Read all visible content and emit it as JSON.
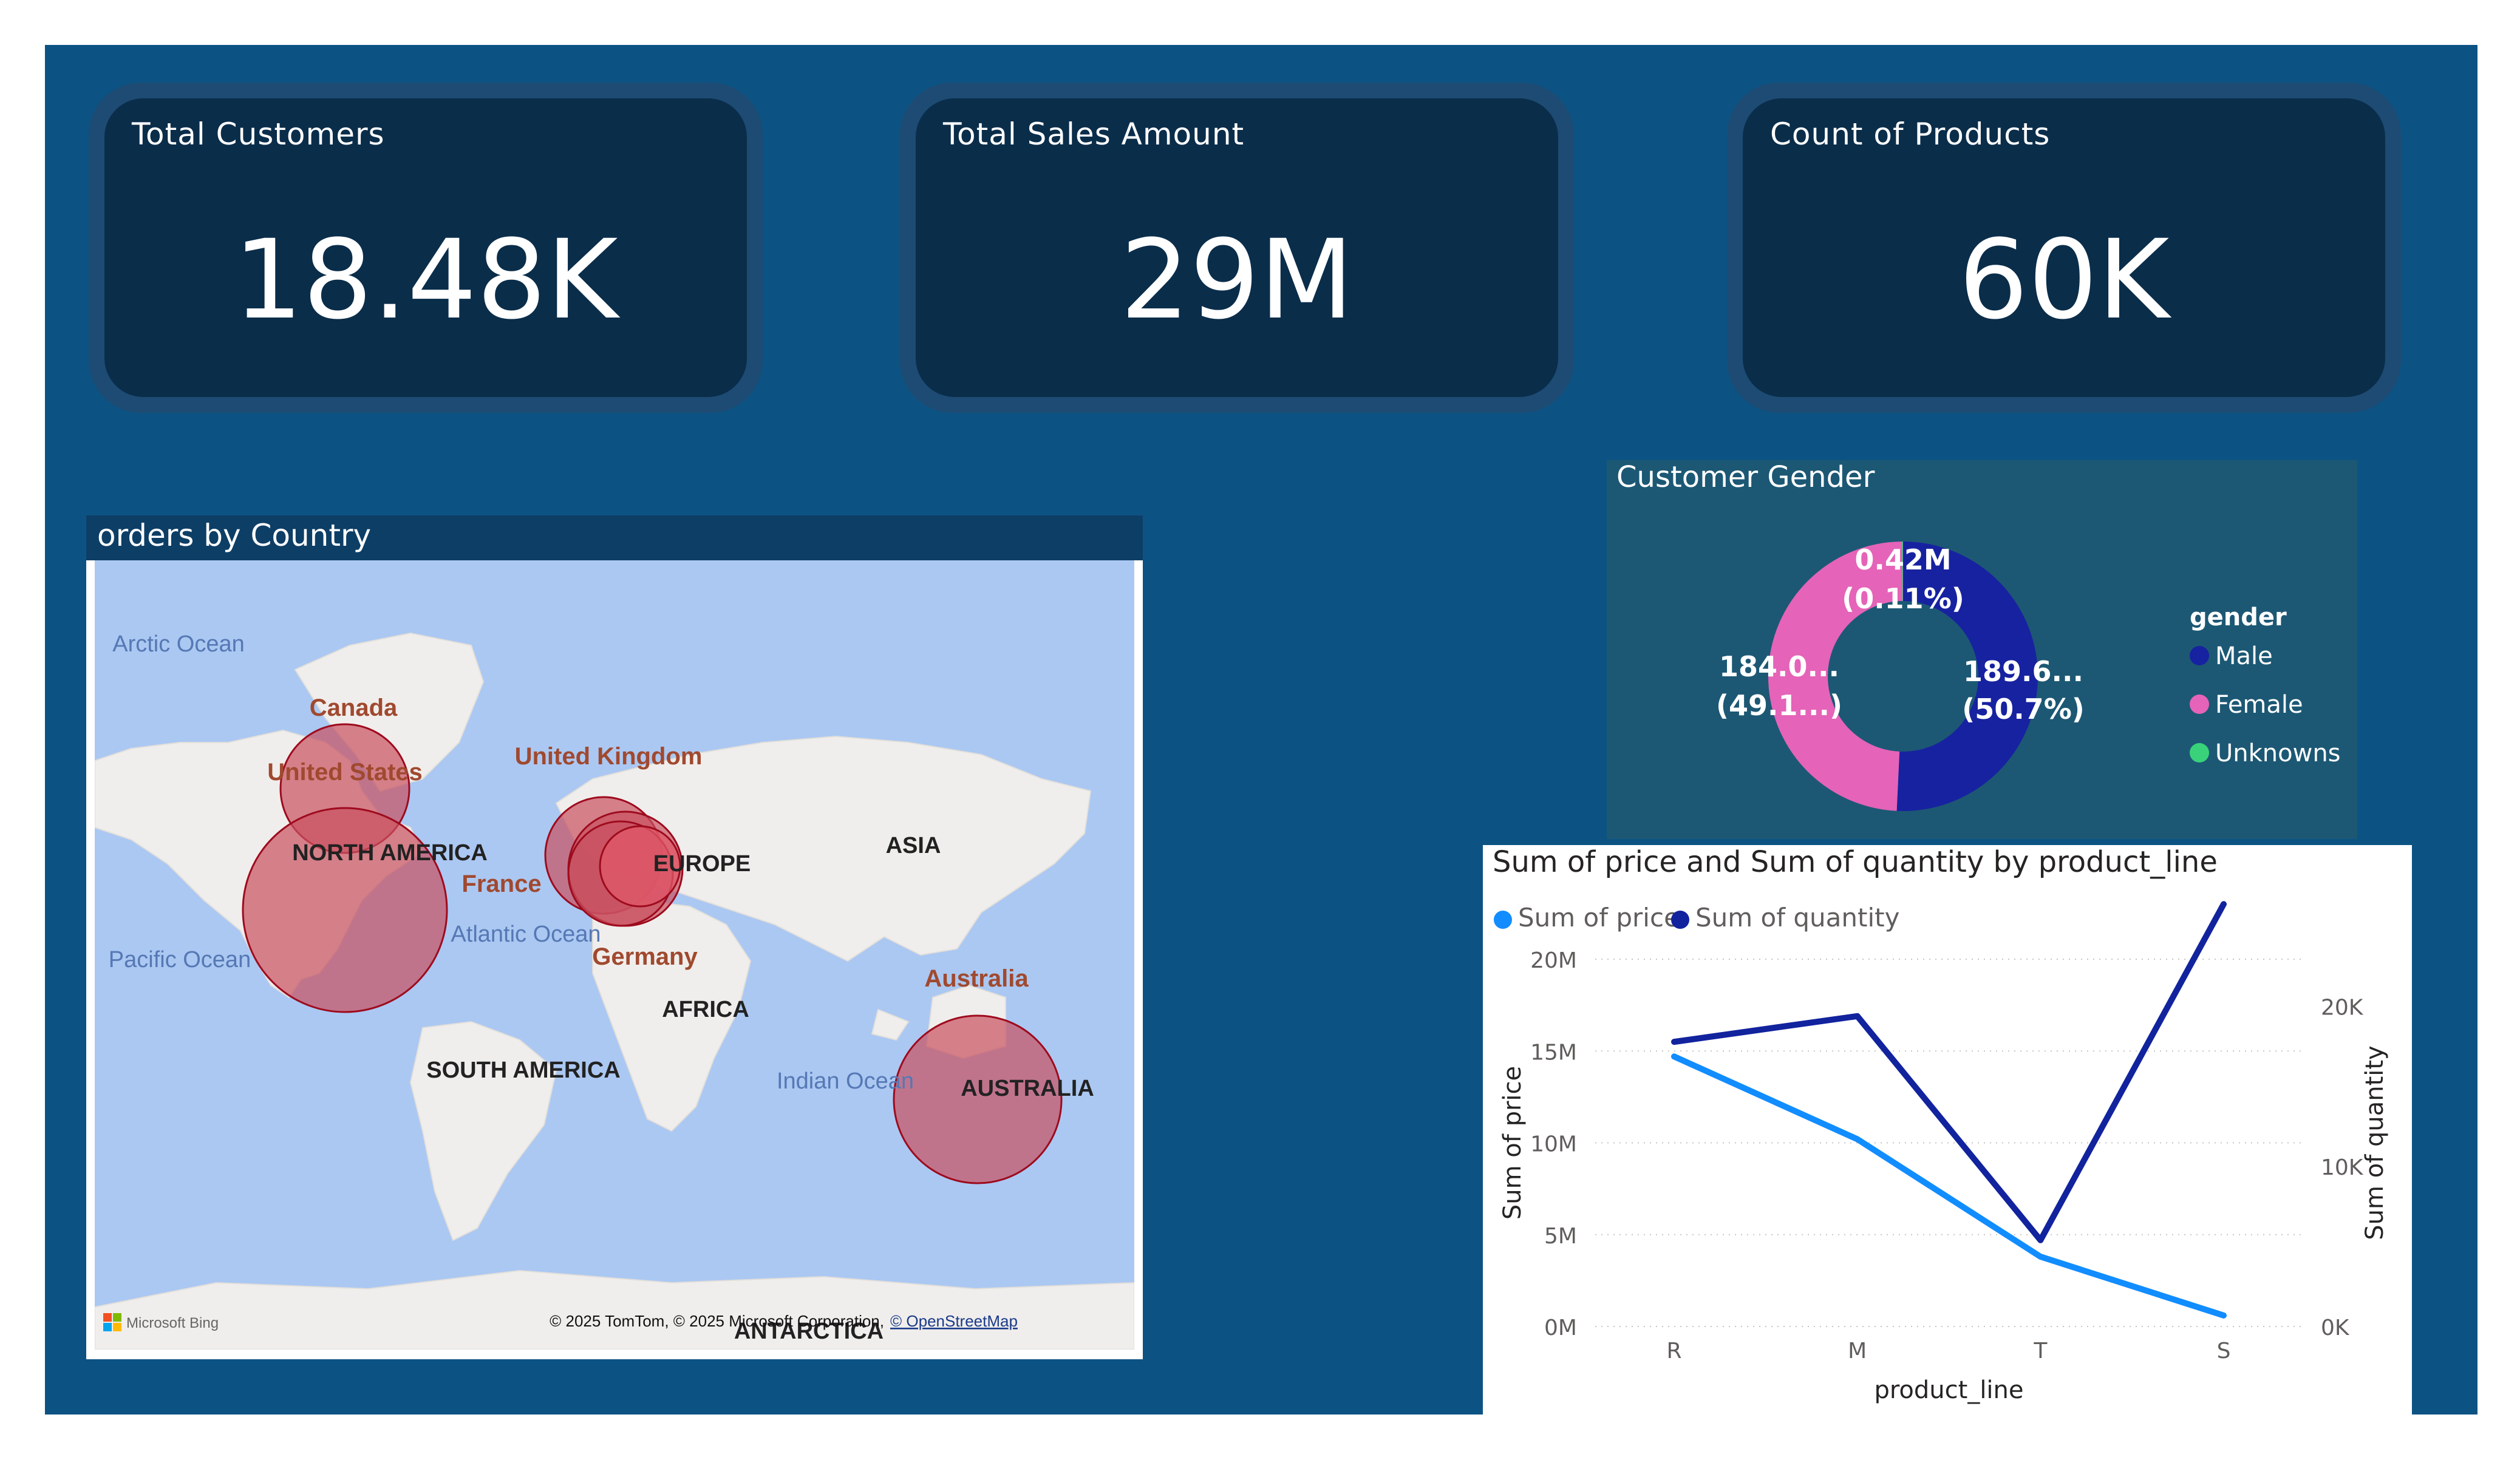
{
  "kpis": [
    {
      "title": "Total Customers",
      "value": "18.48K"
    },
    {
      "title": "Total Sales Amount",
      "value": "29M"
    },
    {
      "title": "Count of Products",
      "value": "60K"
    }
  ],
  "map": {
    "title": "orders by Country",
    "country_labels": [
      "Canada",
      "United States",
      "United Kingdom",
      "France",
      "Germany",
      "Australia"
    ],
    "region_labels": [
      "NORTH AMERICA",
      "EUROPE",
      "ASIA",
      "AFRICA",
      "SOUTH AMERICA",
      "AUSTRALIA",
      "ANTARCTICA"
    ],
    "ocean_labels": [
      "Arctic Ocean",
      "Pacific Ocean",
      "Atlantic Ocean",
      "Indian Ocean"
    ],
    "brand": "Microsoft Bing",
    "attribution": "© 2025 TomTom, © 2025 Microsoft Corporation,",
    "attribution_link": "© OpenStreetMap",
    "bubble_color": "#c9505f"
  },
  "gender": {
    "title": "Customer Gender",
    "legend_title": "gender",
    "legend": [
      "Male",
      "Female",
      "Unknowns"
    ],
    "colors": [
      "#1722a0",
      "#e563b8",
      "#39d27a"
    ],
    "labels": [
      {
        "value": "189.6...",
        "pct": "(50.7%)"
      },
      {
        "value": "184.0...",
        "pct": "(49.1...)"
      },
      {
        "value": "0.42M",
        "pct": "(0.11%)"
      }
    ]
  },
  "chart_data": {
    "type": "line",
    "title": "Sum of price and Sum of quantity by product_line",
    "xlabel": "product_line",
    "ylabel": "Sum of price",
    "y2label": "Sum of quantity",
    "categories": [
      "R",
      "M",
      "T",
      "S"
    ],
    "y_ticks": [
      "0M",
      "5M",
      "10M",
      "15M",
      "20M"
    ],
    "y2_ticks": [
      "0K",
      "10K",
      "20K"
    ],
    "ylim": [
      0,
      20000000
    ],
    "y2lim": [
      0,
      20000
    ],
    "series": [
      {
        "name": "Sum of price",
        "axis": "left",
        "color": "#118dff",
        "values": [
          14700000,
          10200000,
          3800000,
          600000
        ]
      },
      {
        "name": "Sum of quantity",
        "axis": "right",
        "color": "#12239e",
        "values": [
          15500000,
          16900000,
          4700000,
          23000000
        ]
      }
    ],
    "grid": true,
    "legend": "top-left"
  }
}
